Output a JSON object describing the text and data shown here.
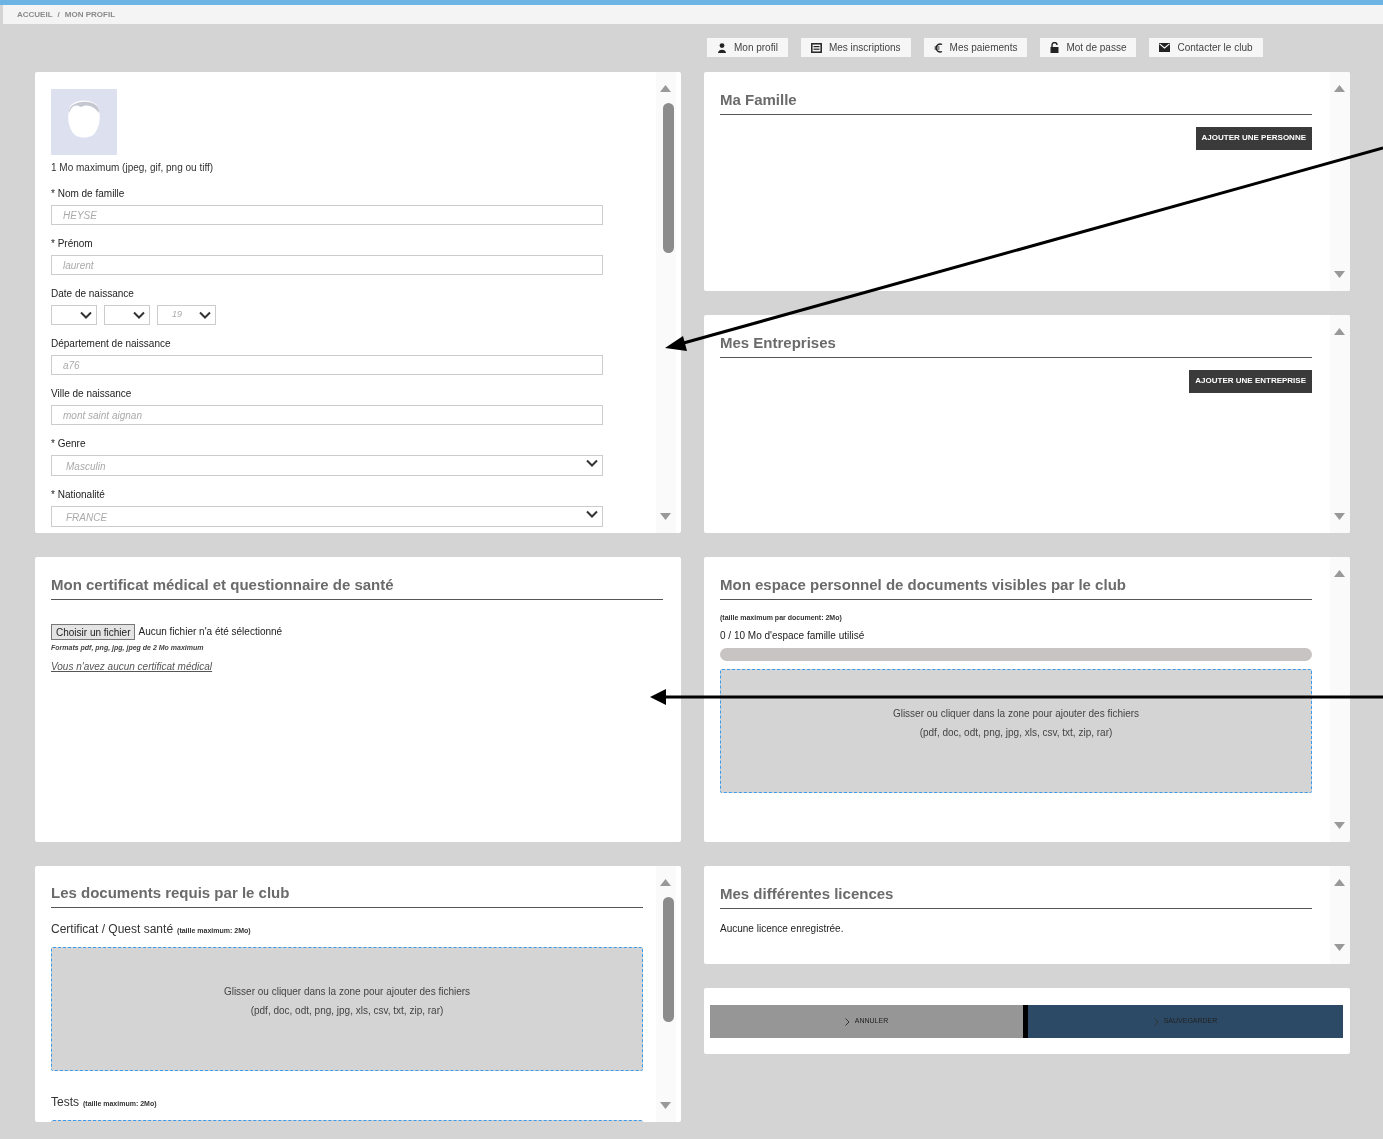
{
  "breadcrumb": [
    "ACCUEIL",
    "/",
    "MON PROFIL"
  ],
  "toolbar": [
    {
      "label": "Mon profil"
    },
    {
      "label": "Mes inscriptions"
    },
    {
      "label": "Mes paiements"
    },
    {
      "label": "Mot de passe"
    },
    {
      "label": "Contacter le club"
    }
  ],
  "profile": {
    "photo_hint": "1 Mo maximum (jpeg, gif, png ou tiff)",
    "fields": [
      {
        "kind": "text",
        "label": "* Nom de famille",
        "value": "HEYSE"
      },
      {
        "kind": "text",
        "label": "* Prénom",
        "value": "laurent"
      },
      {
        "kind": "date",
        "label": "Date de naissance",
        "selects": [
          {
            "kind": "day"
          },
          {
            "kind": "month"
          },
          {
            "kind": "year",
            "value": "19"
          }
        ]
      },
      {
        "kind": "text",
        "label": "Département de naissance",
        "value": "a76"
      },
      {
        "kind": "text",
        "label": "Ville de naissance",
        "value": "mont saint aignan"
      },
      {
        "kind": "select",
        "label": "* Genre",
        "value": "Masculin"
      },
      {
        "kind": "select",
        "label": "* Nationalité",
        "value": "FRANCE"
      }
    ]
  },
  "famille": {
    "title": "Ma Famille",
    "button": "AJOUTER UNE PERSONNE"
  },
  "entreprises": {
    "title": "Mes Entreprises",
    "button": "AJOUTER UNE ENTREPRISE"
  },
  "certificat": {
    "title": "Mon certificat médical et questionnaire de santé",
    "file_button": "Choisir un fichier",
    "file_status": "Aucun fichier n'a été sélectionné",
    "hint": "Formats pdf, png, jpg, jpeg de 2 Mo maximum",
    "link": "Vous n'avez aucun certificat médical"
  },
  "espace": {
    "title": "Mon espace personnel de documents visibles par le club",
    "note": "(taille maximum par document: 2Mo)",
    "usage": "0 / 10 Mo d'espace famille utilisé",
    "level": 0,
    "dropzone": [
      "Glisser ou cliquer dans la zone pour ajouter des fichiers",
      "(pdf, doc, odt, png, jpg, xls, csv, txt, zip, rar)"
    ]
  },
  "documents": {
    "title": "Les documents requis par le club",
    "sections": [
      {
        "label": "Certificat / Quest santé",
        "note": "(taille maximum: 2Mo)",
        "dropzone": [
          "Glisser ou cliquer dans la zone pour ajouter des fichiers",
          "(pdf, doc, odt, png, jpg, xls, csv, txt, zip, rar)"
        ]
      },
      {
        "label": "Tests",
        "note": "(taille maximum: 2Mo)"
      }
    ]
  },
  "licences": {
    "title": "Mes différentes licences",
    "text": "Aucune licence enregistrée."
  },
  "actions": {
    "cancel": "ANNULER",
    "save": "SAUVEGARDER"
  }
}
